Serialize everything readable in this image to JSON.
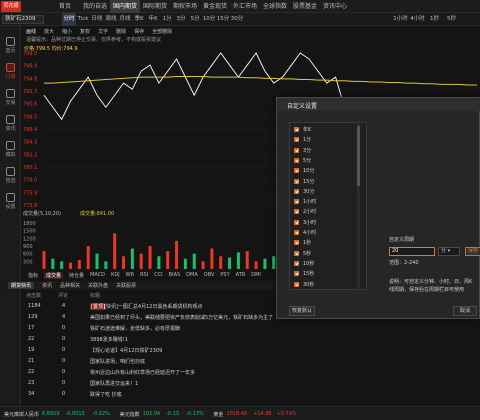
{
  "app": {
    "logo_text": "同花顺"
  },
  "nav": {
    "items": [
      "首页",
      "我的自选",
      "国内期货",
      "国际期货",
      "期权市场",
      "黄金现货",
      "外汇市场",
      "全球指数",
      "股票基金",
      "资讯中心"
    ],
    "active": "国内期货"
  },
  "toolbar": {
    "instrument": "铁矿石2309",
    "timeframes": [
      "分时",
      "Tick",
      "日线",
      "周线",
      "月线",
      "季K",
      "年K",
      "1分",
      "3分",
      "5分",
      "10分",
      "15分",
      "30分"
    ],
    "active_tf": "分时",
    "timeframes_right": [
      "1小时",
      "4小时",
      "1秒",
      "5秒"
    ]
  },
  "drawbar": {
    "items": [
      "画线",
      "放大",
      "缩小",
      "复权",
      "文字",
      "删除",
      "保存",
      "全部删除"
    ]
  },
  "notice": "温馨提示：品种过期已停止交易，仅供参考，不构成投资建议",
  "sidebar": [
    {
      "label": "首页",
      "icon": "home-icon"
    },
    {
      "label": "行情",
      "icon": "chart-icon",
      "active": true
    },
    {
      "label": "交易",
      "icon": "trade-icon"
    },
    {
      "label": "资讯",
      "icon": "news-icon"
    },
    {
      "label": "模拟",
      "icon": "sim-icon"
    },
    {
      "label": "自选",
      "icon": "star-icon"
    },
    {
      "label": "设置",
      "icon": "gear-icon"
    }
  ],
  "chart": {
    "price_label": "价格:799.5 均价:794.9",
    "y_ticks": [
      "799.0",
      "796.9",
      "794.8",
      "792.7",
      "790.6",
      "788.5",
      "786.4",
      "784.3",
      "782.2",
      "780.1",
      "778.0",
      "775.9",
      "773.8"
    ],
    "volume_label": "成交量(5,10,20)",
    "volume_value": "成交量:841.00",
    "vol_ticks": [
      "1800",
      "1500",
      "1200",
      "900",
      "600",
      "300"
    ],
    "colors": {
      "up": "#e8382a",
      "down": "#1fbf6a",
      "price_line": "#ffffff",
      "avg_line": "#d9c93a"
    }
  },
  "chart_data": {
    "type": "line",
    "series": [
      {
        "name": "价格",
        "values": [
          792,
          790,
          788,
          791,
          793,
          795,
          792,
          790,
          792,
          794,
          793,
          796,
          797,
          794,
          796,
          798,
          795,
          792,
          795,
          797,
          799,
          797,
          795,
          797,
          799,
          796,
          794,
          795,
          797,
          799,
          798,
          796,
          794,
          795,
          790,
          787,
          789,
          785,
          788,
          786,
          784,
          786,
          788,
          786,
          783,
          785,
          787,
          785,
          783,
          786
        ]
      },
      {
        "name": "均价",
        "values": [
          794.0,
          794.0,
          794.1,
          794.2,
          794.3,
          794.4,
          794.5,
          794.6,
          794.7,
          794.8,
          794.9,
          795.0,
          795.0,
          795.0,
          795.0,
          795.1,
          795.1,
          795.1,
          795.1,
          795.0,
          795.0,
          795.0,
          795.0,
          794.9,
          794.9,
          794.8,
          794.8,
          794.7,
          794.7,
          794.6,
          794.6,
          794.5,
          794.5,
          794.4,
          794.4,
          794.3,
          794.3,
          794.2,
          794.2,
          794.1,
          794.1,
          794.0,
          794.0,
          793.9,
          793.9,
          793.8,
          793.8,
          793.8,
          793.7,
          793.7
        ]
      }
    ],
    "volume": [
      700,
      400,
      300,
      250,
      350,
      900,
      600,
      300,
      1400,
      500,
      800,
      600,
      900,
      500,
      700,
      1100,
      400,
      600,
      300,
      800,
      500,
      450,
      650,
      700,
      300,
      400,
      500,
      350,
      600,
      900,
      450,
      300,
      700,
      800,
      550,
      400,
      650,
      300,
      750,
      350,
      500,
      600,
      850,
      400,
      300,
      550,
      700,
      450,
      350,
      600
    ],
    "ylim": [
      773.8,
      799.0
    ]
  },
  "ind_tabs": {
    "items": [
      "成交量",
      "持仓量",
      "MACD",
      "KDJ",
      "WR",
      "RSI",
      "CCI",
      "BIAS",
      "DMA",
      "OBV",
      "PSY",
      "ATR",
      "DMI"
    ],
    "active": "成交量",
    "prefix": "指标"
  },
  "news": {
    "tabs": [
      "期货快讯",
      "资讯",
      "品种相关",
      "关联外盘",
      "关联股票"
    ],
    "active": "期货快讯",
    "headers": [
      "点击数",
      "评论",
      "标题"
    ],
    "rows": [
      {
        "clicks": "1184",
        "comments": "4",
        "tag": "[置顶]",
        "title": "[快讯]一图汇总4月12日黑色系期货机构观点"
      },
      {
        "clicks": "129",
        "comments": "4",
        "title": "美国如果已经到了尽头，美联储要把资产负债表削减5万亿美元，铁矿石缺多为主了"
      },
      {
        "clicks": "17",
        "comments": "0",
        "title": "铁矿石迷途难解，走低缺多，必有厚报酬"
      },
      {
        "clicks": "22",
        "comments": "0",
        "title": "3898涨多赚钱!1"
      },
      {
        "clicks": "19",
        "comments": "0",
        "title": "【观心论道】4月12日铁矿2309"
      },
      {
        "clicks": "21",
        "comments": "0",
        "title": "国家队进场，咱们也抄底"
      },
      {
        "clicks": "22",
        "comments": "0",
        "title": "常州近边山外有山利红草场已经延迟开了一年多"
      },
      {
        "clicks": "23",
        "comments": "0",
        "title": "国家队再进交运来！1"
      },
      {
        "clicks": "34",
        "comments": "0",
        "title": "跌得了吃 抄底"
      }
    ]
  },
  "status": {
    "items": [
      {
        "label": "美元离岸人民币",
        "value": "6.8929",
        "change": "-0.0013",
        "pct": "-0.02%",
        "color": "#1fbf6a"
      },
      {
        "label": "美元指数",
        "value": "102.04",
        "change": "-0.13",
        "pct": "-0.13%",
        "color": "#1fbf6a"
      },
      {
        "label": "黄金",
        "value": "2018.48",
        "change": "+14.86",
        "pct": "+0.74%",
        "color": "#e8382a"
      }
    ]
  },
  "dialog": {
    "title": "自定义设置",
    "items": [
      "年K",
      "1分",
      "3分",
      "5分",
      "10分",
      "15分",
      "30分",
      "1小时",
      "2小时",
      "3小时",
      "4小时",
      "1秒",
      "5秒",
      "10秒",
      "15秒",
      "30秒"
    ],
    "period_label": "自定义周期",
    "period_value": "20",
    "period_unit": "分",
    "save_label": "保存",
    "range_hint": "范围：2-240",
    "help_text": "说明：可自定义分钟、小时、日、周K线周期，保存后在周期栏目可使用",
    "reset_label": "恢复默认",
    "cancel_label": "取消"
  }
}
